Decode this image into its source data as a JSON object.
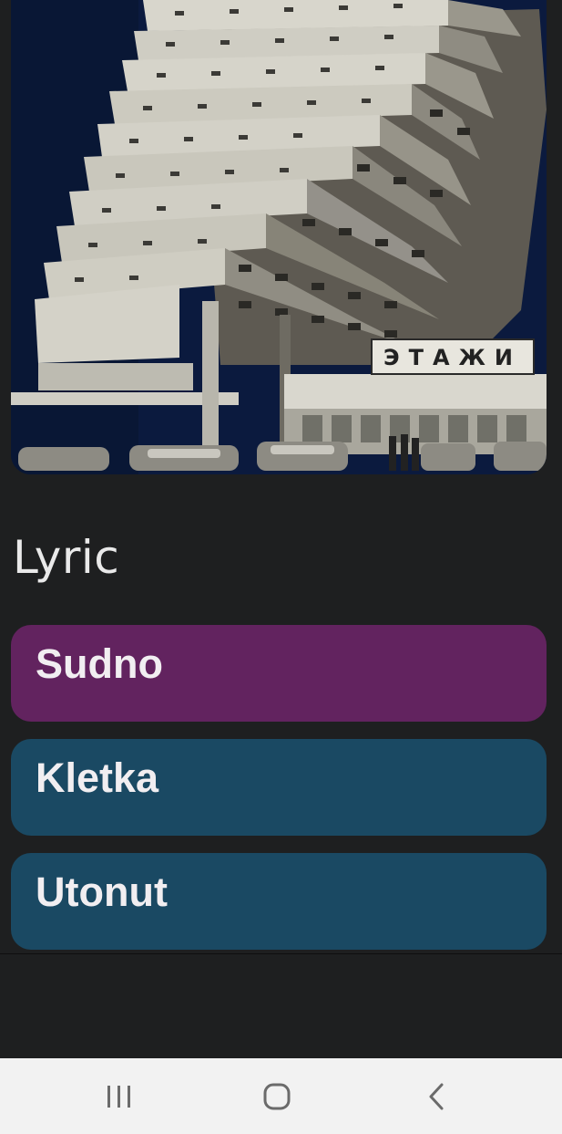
{
  "cover": {
    "sign_text": "ЭТАЖИ"
  },
  "section": {
    "title": "Lyric"
  },
  "tracks": [
    {
      "label": "Sudno",
      "color": "#62235f"
    },
    {
      "label": "Kletka",
      "color": "#1a4963"
    },
    {
      "label": "Utonut",
      "color": "#1a4963"
    }
  ],
  "navbar": {
    "icons": [
      "recent-apps-icon",
      "home-icon",
      "back-icon"
    ],
    "background": "#f2f2f2"
  }
}
